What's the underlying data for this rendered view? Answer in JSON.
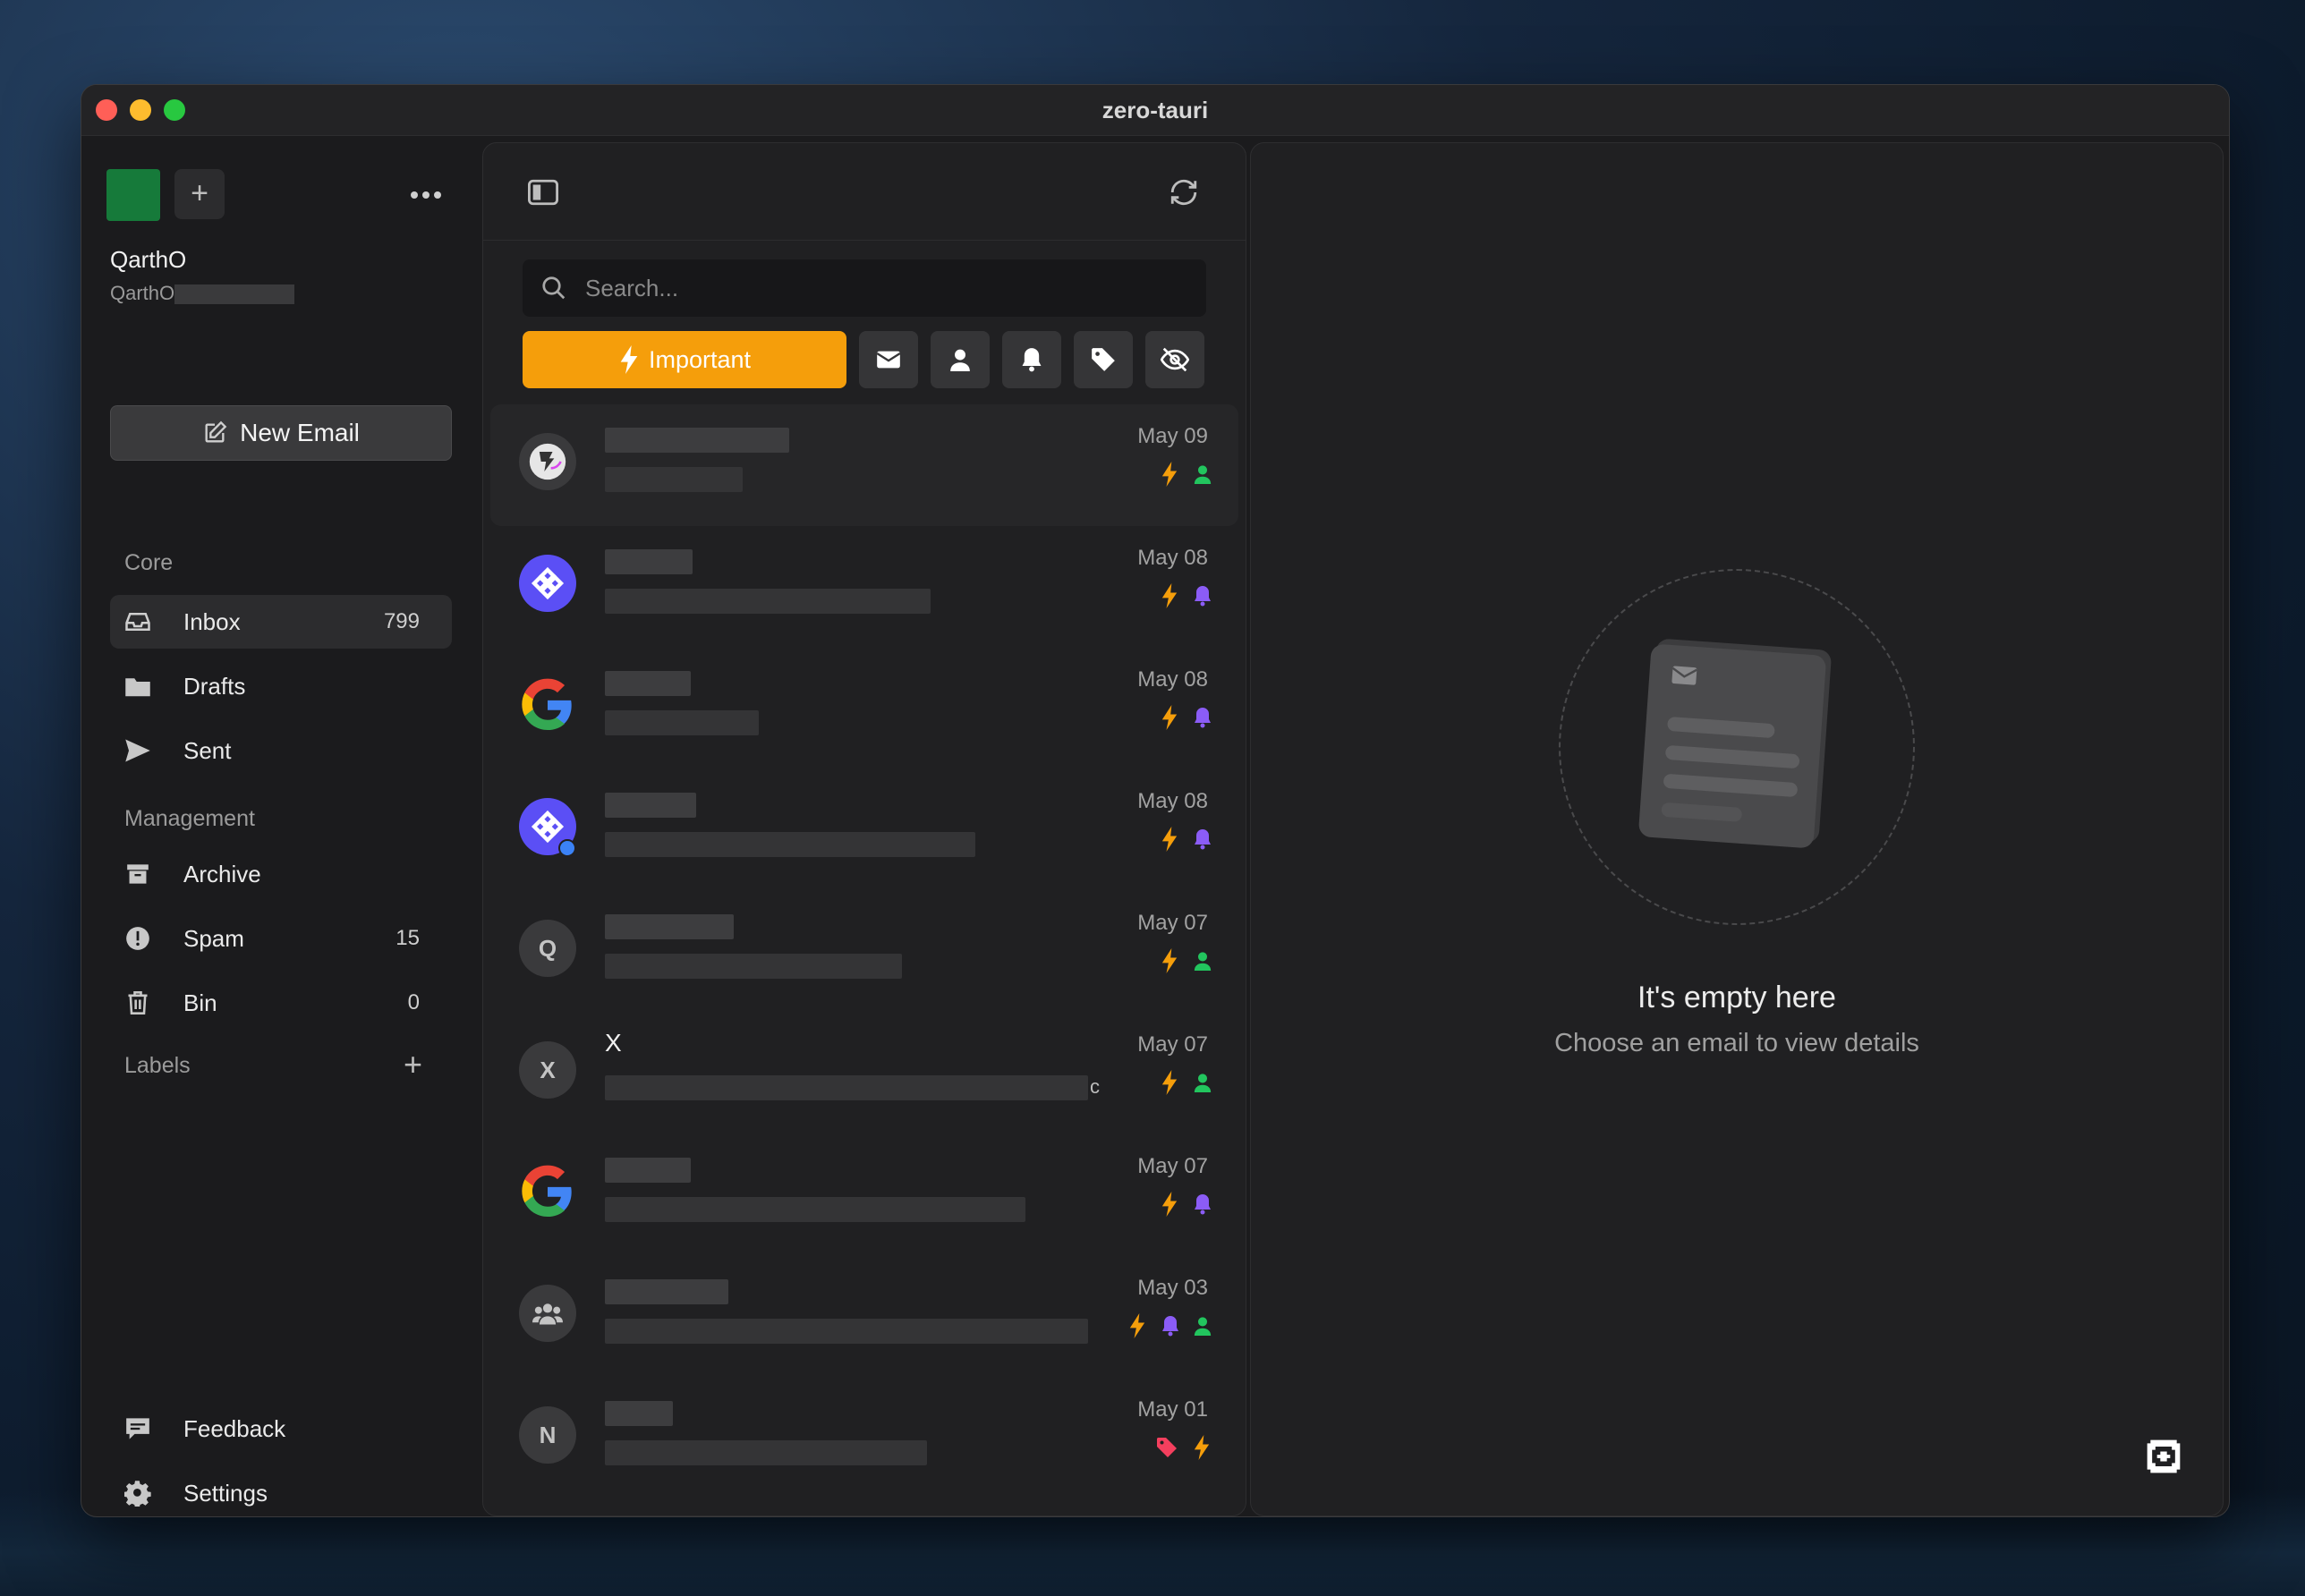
{
  "window": {
    "title": "zero-tauri"
  },
  "account": {
    "name": "QarthO",
    "email_prefix": "QarthO",
    "avatar_color": "#167a3a"
  },
  "sidebar": {
    "new_email_label": "New Email",
    "sections": {
      "core": "Core",
      "management": "Management",
      "labels": "Labels"
    },
    "items": [
      {
        "label": "Inbox",
        "count": "799",
        "icon": "inbox-icon"
      },
      {
        "label": "Drafts",
        "count": "",
        "icon": "folder-icon"
      },
      {
        "label": "Sent",
        "count": "",
        "icon": "send-icon"
      },
      {
        "label": "Archive",
        "count": "",
        "icon": "archive-icon"
      },
      {
        "label": "Spam",
        "count": "15",
        "icon": "alert-circle-icon"
      },
      {
        "label": "Bin",
        "count": "0",
        "icon": "trash-icon"
      }
    ],
    "footer": [
      {
        "label": "Feedback",
        "icon": "message-icon"
      },
      {
        "label": "Settings",
        "icon": "gear-icon"
      }
    ]
  },
  "list": {
    "search_placeholder": "Search...",
    "filters": {
      "important_label": "Important",
      "icons": [
        "mail-icon",
        "person-icon",
        "bell-icon",
        "tag-icon",
        "eye-off-icon"
      ]
    },
    "emails": [
      {
        "avatar": "image",
        "sender": "",
        "date": "May 09",
        "tags": [
          "bolt",
          "person"
        ]
      },
      {
        "avatar": "brand-purple",
        "sender": "",
        "date": "May 08",
        "tags": [
          "bolt",
          "bell"
        ]
      },
      {
        "avatar": "google",
        "sender": "",
        "date": "May 08",
        "tags": [
          "bolt",
          "bell"
        ]
      },
      {
        "avatar": "brand-purple",
        "sender": "",
        "date": "May 08",
        "tags": [
          "bolt",
          "bell"
        ]
      },
      {
        "avatar": "Q",
        "sender": "",
        "date": "May 07",
        "tags": [
          "bolt",
          "person"
        ]
      },
      {
        "avatar": "X",
        "sender": "X",
        "subject_tail": "c",
        "date": "May 07",
        "tags": [
          "bolt",
          "person"
        ]
      },
      {
        "avatar": "google",
        "sender": "",
        "date": "May 07",
        "tags": [
          "bolt",
          "bell"
        ]
      },
      {
        "avatar": "group",
        "sender": "",
        "date": "May 03",
        "tags": [
          "bolt",
          "bell",
          "person"
        ]
      },
      {
        "avatar": "N",
        "sender": "",
        "date": "May 01",
        "tags": [
          "tag",
          "bolt"
        ]
      }
    ]
  },
  "detail": {
    "empty_title": "It's empty here",
    "empty_subtitle": "Choose an email to view details"
  },
  "colors": {
    "important": "#f59e0b",
    "bolt": "#f59e0b",
    "person": "#22c55e",
    "bell": "#8b5cf6",
    "tag": "#f43f5e"
  }
}
